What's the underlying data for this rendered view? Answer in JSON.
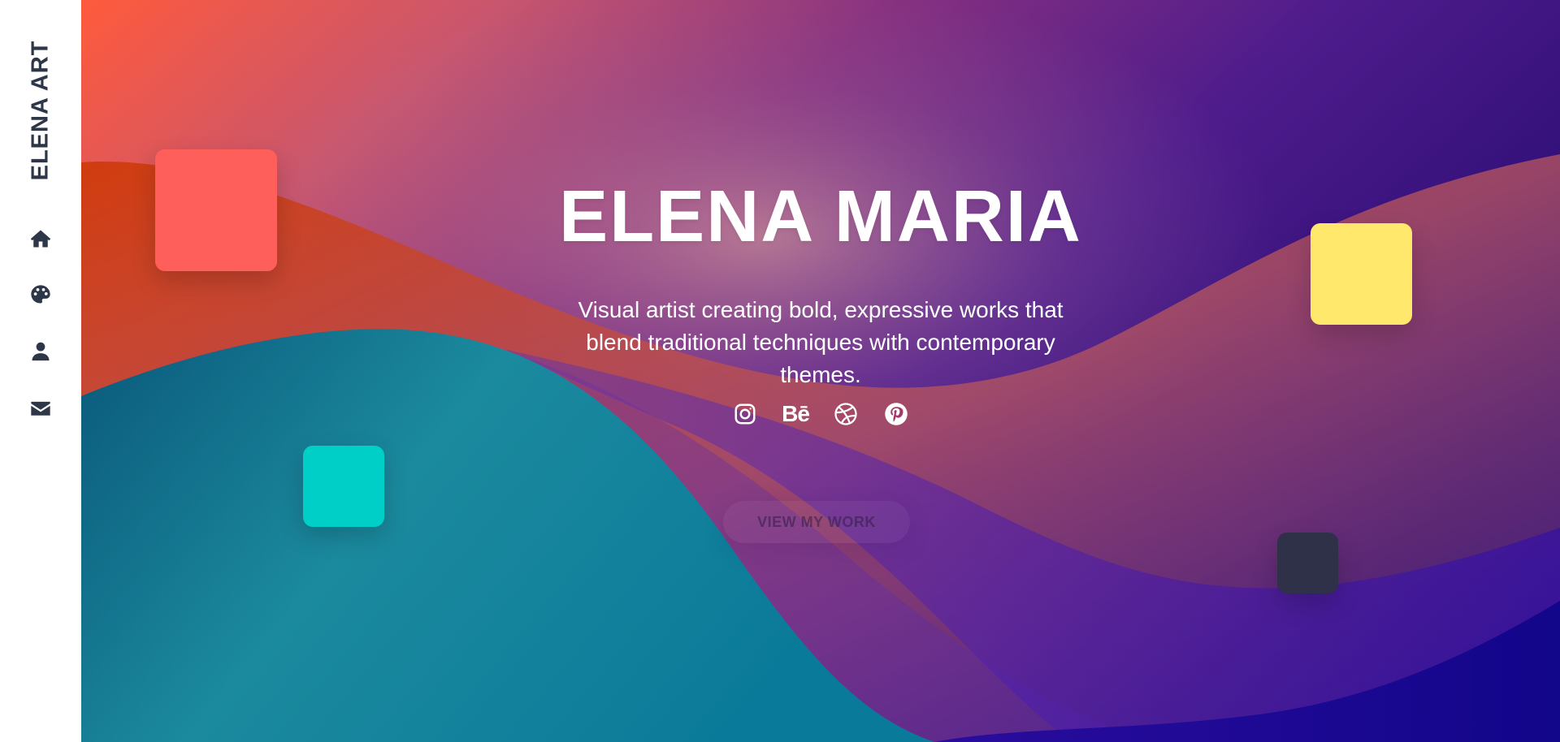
{
  "sidebar": {
    "brand": "ELENA ART",
    "nav": [
      {
        "id": "home",
        "icon": "home-icon"
      },
      {
        "id": "gallery",
        "icon": "palette-icon"
      },
      {
        "id": "about",
        "icon": "user-icon"
      },
      {
        "id": "contact",
        "icon": "envelope-icon"
      }
    ]
  },
  "hero": {
    "title": "ELENA MARIA",
    "subtitle": "Visual artist creating bold, expressive works that blend traditional techniques with contemporary themes.",
    "social": [
      {
        "id": "instagram",
        "icon": "instagram-icon"
      },
      {
        "id": "behance",
        "icon": "behance-icon",
        "text": "Bē"
      },
      {
        "id": "dribbble",
        "icon": "dribbble-icon"
      },
      {
        "id": "pinterest",
        "icon": "pinterest-icon"
      }
    ],
    "cta_label": "VIEW MY WORK"
  },
  "colors": {
    "sidebar_text": "#2d3748",
    "coral_square": "#ff5f5a",
    "yellow_square": "#ffe86b",
    "teal_square": "#00cfc8",
    "navy_square": "#2e3148",
    "gradient_orange": "#ff5a3c",
    "gradient_purple": "#7a2c8c",
    "gradient_indigo": "#2a0a8a",
    "wave_teal": "#0a6a8a"
  }
}
